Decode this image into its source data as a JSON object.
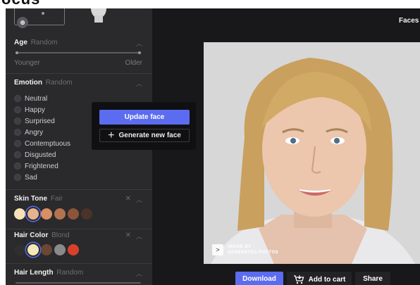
{
  "top": {
    "partial_heading": "ocus"
  },
  "sidebar": {
    "badge_glyph": "⊕",
    "age": {
      "label": "Age",
      "value": "Random",
      "min_label": "Younger",
      "max_label": "Older"
    },
    "emotion": {
      "label": "Emotion",
      "value": "Random",
      "options": [
        "Neutral",
        "Happy",
        "Surprised",
        "Angry",
        "Contemptuous",
        "Disgusted",
        "Frightened",
        "Sad"
      ]
    },
    "skin_tone": {
      "label": "Skin Tone",
      "value": "Fair",
      "swatches": [
        "#f7e2b5",
        "#e5b48d",
        "#d88f62",
        "#b3734f",
        "#8c553a",
        "#4a3328"
      ],
      "selected_index": 1
    },
    "hair_color": {
      "label": "Hair Color",
      "value": "Blond",
      "swatches": [
        "#2f2f2f",
        "#f4e7b8",
        "#6a4735",
        "#8a8a8a",
        "#d9402c"
      ],
      "selected_index": 1
    },
    "hair_length": {
      "label": "Hair Length",
      "value": "Random"
    }
  },
  "popup": {
    "update_label": "Update face",
    "generate_label": "Generate new face"
  },
  "main": {
    "faces_label": "Faces",
    "watermark": {
      "line1": "IMAGE BY",
      "line2": "GENERATED.PHOTOS"
    },
    "actions": {
      "download": "Download",
      "add_to_cart": "Add to cart",
      "share": "Share"
    }
  }
}
